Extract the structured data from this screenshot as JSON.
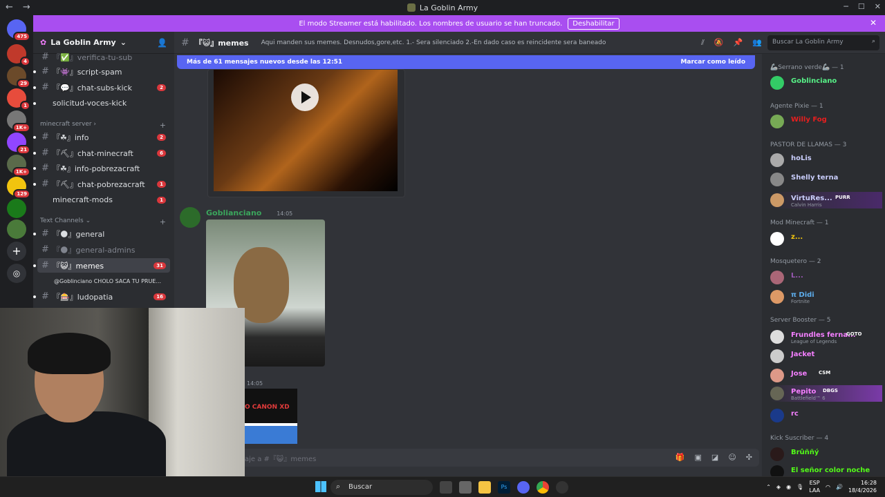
{
  "window": {
    "title": "La Goblin Army",
    "back": "←",
    "forward": "→",
    "buttons": [
      "─",
      "☐",
      "✕"
    ]
  },
  "banner": {
    "text": "El modo Streamer está habilitado. Los nombres de usuario se han truncado.",
    "button": "Deshabilitar",
    "close": "✕"
  },
  "servers": {
    "badges": [
      "475",
      "4",
      "29",
      "1",
      "1K+",
      "21",
      "1K+",
      "129"
    ]
  },
  "sidebar": {
    "server_name": "La Goblin Army",
    "channels": [
      {
        "label": "『✅』verifica-tu-sub",
        "badge": "",
        "muted": true
      },
      {
        "label": "『👾』script-spam",
        "badge": "",
        "muted": false
      },
      {
        "label": "『💬』chat-subs-kick",
        "badge": "2",
        "muted": false
      },
      {
        "label": "solicitud-voces-kick",
        "badge": "",
        "muted": false
      },
      {
        "label": "『☘』info",
        "badge": "2",
        "muted": false
      },
      {
        "label": "『⛏』chat-minecraft",
        "badge": "6",
        "muted": false
      },
      {
        "label": "『☘』info-pobrezacraft",
        "badge": "",
        "muted": false
      },
      {
        "label": "『⛏』chat-pobrezacraft",
        "badge": "1",
        "muted": false
      },
      {
        "label": "minecraft-mods",
        "badge": "1",
        "muted": false
      },
      {
        "label": "『🌑』general",
        "badge": "",
        "muted": false
      },
      {
        "label": "『🌑』general-admins",
        "badge": "",
        "muted": true
      },
      {
        "label": "『😺』memes",
        "badge": "31",
        "muted": false
      },
      {
        "label": "『🎰』ludopatia",
        "badge": "16",
        "muted": false
      }
    ],
    "categories": [
      "minecraft server",
      "Text Channels"
    ],
    "thread": "@Goblinciano CHOLO SACA TU PRUE..."
  },
  "header": {
    "channel": "『😺』memes",
    "topic": "Aqui manden sus memes. Desnudos,gore,etc. 1.- Sera silenciado 2.-En dado caso es reincidente sera baneado",
    "search_placeholder": "Buscar La Goblin Army"
  },
  "main": {
    "new_messages": "Más de 61 mensajes nuevos desde las 12:51",
    "mark_read": "Marcar como leído",
    "message": {
      "author": "Goblianciano",
      "time": "14:05"
    },
    "second_time": "14:05",
    "thumb_text": "O CANON XD",
    "input_placeholder": "aje a #『😺』memes"
  },
  "members": {
    "groups": [
      {
        "title": "🦾Serrano verde🦾 — 1",
        "members": [
          {
            "name": "Goblinciano",
            "color": "#57f287",
            "sub": ""
          }
        ]
      },
      {
        "title": "Agente Pixie — 1",
        "members": [
          {
            "name": "Willy Fog",
            "color": "#e91e1e",
            "sub": ""
          }
        ]
      },
      {
        "title": "PASTOR DE LLAMAS — 3",
        "members": [
          {
            "name": "hoLis",
            "color": "#c9cdfb",
            "sub": ""
          },
          {
            "name": "Shelly terna",
            "color": "#c9cdfb",
            "sub": ""
          },
          {
            "name": "VirtuRes...",
            "color": "#c9cdfb",
            "sub": "Calvin Harris",
            "tag": "PURR"
          }
        ]
      },
      {
        "title": "Mod Minecraft — 1",
        "members": [
          {
            "name": "z...",
            "color": "#f1c40f",
            "sub": ""
          }
        ]
      },
      {
        "title": "Mosquetero — 2",
        "members": [
          {
            "name": "L...",
            "color": "#9b59b6",
            "sub": ""
          },
          {
            "name": "π Didi",
            "color": "#5dadec",
            "sub": "Fortnite"
          }
        ]
      },
      {
        "title": "Server Booster — 5",
        "members": [
          {
            "name": "Frundles ferna...",
            "color": "#f47fff",
            "sub": "League of Legends",
            "tag": "GOTO"
          },
          {
            "name": "Jacket",
            "color": "#f47fff",
            "sub": ""
          },
          {
            "name": "Jose",
            "color": "#f47fff",
            "sub": "",
            "tag": "CSM"
          },
          {
            "name": "Pepito",
            "color": "#f47fff",
            "sub": "Battlefield™ 6",
            "tag": "DBGS"
          },
          {
            "name": "rc",
            "color": "#f47fff",
            "sub": ""
          }
        ]
      },
      {
        "title": "Kick Suscriber — 4",
        "members": [
          {
            "name": "Brûññý",
            "color": "#53fc18",
            "sub": ""
          },
          {
            "name": "El señor color noche",
            "color": "#53fc18",
            "sub": ""
          }
        ]
      }
    ]
  },
  "taskbar": {
    "search": "Buscar",
    "lang1": "ESP",
    "lang2": "LAA",
    "time": "16:28",
    "date": "18/4/2026"
  }
}
